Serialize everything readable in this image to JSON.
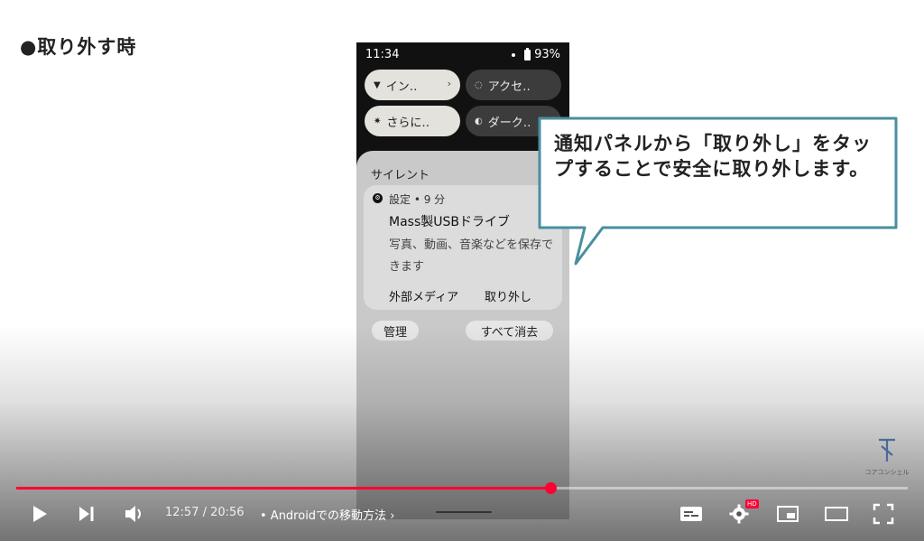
{
  "heading": "●取り外す時",
  "phone": {
    "status": {
      "time": "11:34",
      "battery": "93%"
    },
    "quick_settings": [
      {
        "label": "イン‥",
        "icon": "wifi-icon",
        "chevron": "›"
      },
      {
        "label": "アクセ‥",
        "icon": "accessibility-icon"
      },
      {
        "label": "さらに‥",
        "icon": "brightness-icon"
      },
      {
        "label": "ダーク‥",
        "icon": "dark-mode-icon"
      }
    ],
    "section_label": "サイレント",
    "notification": {
      "app_header": "設定 • 9 分",
      "title": "Mass製USBドライブ",
      "body": "写真、動画、音楽などを保存できます",
      "actions": [
        "外部メディア",
        "取り外し"
      ]
    },
    "buttons": {
      "manage": "管理",
      "clear_all": "すべて消去"
    }
  },
  "callout": {
    "text": "通知パネルから「取り外し」をタップすることで安全に取り外します。",
    "border_color": "#4a8f9f"
  },
  "player": {
    "current_time": "12:57",
    "duration": "20:56",
    "time_display": "12:57 / 20:56",
    "chapter": "• Androidでの移動方法 ›",
    "progress": 0.6,
    "hd_badge": "HD",
    "accent_color": "#ff0033"
  },
  "logo": {
    "caption": "コアコンシェル"
  }
}
